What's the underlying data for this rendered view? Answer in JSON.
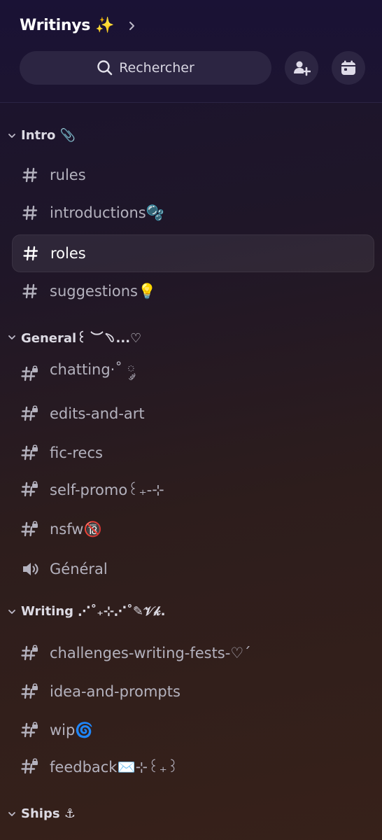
{
  "header": {
    "server_name": "Writinys ✨",
    "search_label": "Rechercher"
  },
  "categories": [
    {
      "label": "Intro 📎",
      "channels": [
        {
          "label": "rules",
          "icon": "hash-icon",
          "locked": false,
          "selected": false
        },
        {
          "label": "introductions🫧",
          "icon": "hash-icon",
          "locked": false,
          "selected": false
        },
        {
          "label": "roles",
          "icon": "hash-icon",
          "locked": false,
          "selected": true
        },
        {
          "label": "suggestions💡",
          "icon": "hash-icon",
          "locked": false,
          "selected": false
        }
      ]
    },
    {
      "label": "General꒰ ︶﹆...♡",
      "channels": [
        {
          "label": "chatting·˚ ༘",
          "icon": "locked-hash-icon",
          "locked": true,
          "selected": false
        },
        {
          "label": "edits-and-art",
          "icon": "locked-hash-icon",
          "locked": true,
          "selected": false
        },
        {
          "label": "fic-recs",
          "icon": "locked-hash-icon",
          "locked": true,
          "selected": false
        },
        {
          "label": "self-promo꒰₊-⊹",
          "icon": "locked-hash-icon",
          "locked": true,
          "selected": false
        },
        {
          "label": "nsfw🔞",
          "icon": "locked-hash-icon",
          "locked": true,
          "selected": false
        },
        {
          "label": "Général",
          "icon": "speaker-icon",
          "locked": false,
          "selected": false
        }
      ]
    },
    {
      "label": "Writing ⋰˚₊⊹⋰˚✎𝒱𝓀.",
      "channels": [
        {
          "label": "challenges-writing-fests-♡´",
          "icon": "locked-hash-icon",
          "locked": true,
          "selected": false
        },
        {
          "label": "idea-and-prompts",
          "icon": "locked-hash-icon",
          "locked": true,
          "selected": false
        },
        {
          "label": "wip🌀",
          "icon": "locked-hash-icon",
          "locked": true,
          "selected": false
        },
        {
          "label": "feedback✉️⊹꒰₊꒱",
          "icon": "locked-hash-icon",
          "locked": true,
          "selected": false
        }
      ]
    },
    {
      "label": "Ships ⚓",
      "channels": []
    }
  ],
  "colors": {
    "header_bg": "#1a1235",
    "pill_bg": "#2c2542",
    "channel_text": "#b4b2be",
    "selected_text": "#ffffff",
    "category_text": "#dcdae3"
  }
}
